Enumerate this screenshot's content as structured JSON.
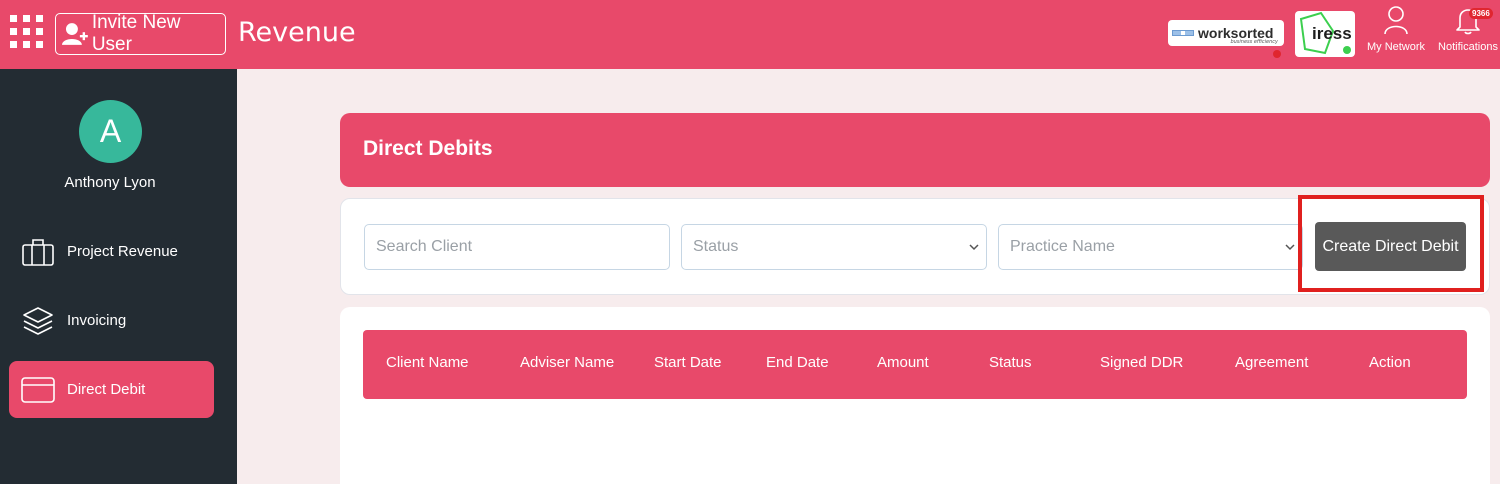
{
  "topbar": {
    "menu_icon": "apps-grid-icon",
    "invite_label": "Invite New User",
    "invite_icon": "add-user-icon",
    "page_title": "Revenue",
    "integrations": [
      {
        "name": "worksorted",
        "tagline": "business efficiency",
        "status_color": "#e0262f"
      },
      {
        "name": "iress",
        "status_color": "#3ccf4e"
      }
    ],
    "network_label": "My Network",
    "network_icon": "person-icon",
    "notifications_label": "Notifications",
    "notifications_icon": "bell-icon",
    "notifications_count": "9366"
  },
  "sidebar": {
    "avatar_initial": "A",
    "user_name": "Anthony Lyon",
    "items": [
      {
        "label": "Project Revenue",
        "icon": "briefcase-icon",
        "active": false
      },
      {
        "label": "Invoicing",
        "icon": "layers-icon",
        "active": false
      },
      {
        "label": "Direct Debit",
        "icon": "card-icon",
        "active": true
      }
    ]
  },
  "main": {
    "section_title": "Direct Debits",
    "filters": {
      "search_placeholder": "Search Client",
      "status_placeholder": "Status",
      "practice_placeholder": "Practice Name"
    },
    "create_button": "Create Direct Debit",
    "table": {
      "columns": [
        "Client Name",
        "Adviser Name",
        "Start Date",
        "End Date",
        "Amount",
        "Status",
        "Signed DDR",
        "Agreement",
        "Action"
      ]
    }
  },
  "colors": {
    "brand": "#e8496a",
    "sidebar_bg": "#232c33",
    "avatar": "#37b89b",
    "button_dark": "#595959",
    "highlight": "#e0201f"
  }
}
